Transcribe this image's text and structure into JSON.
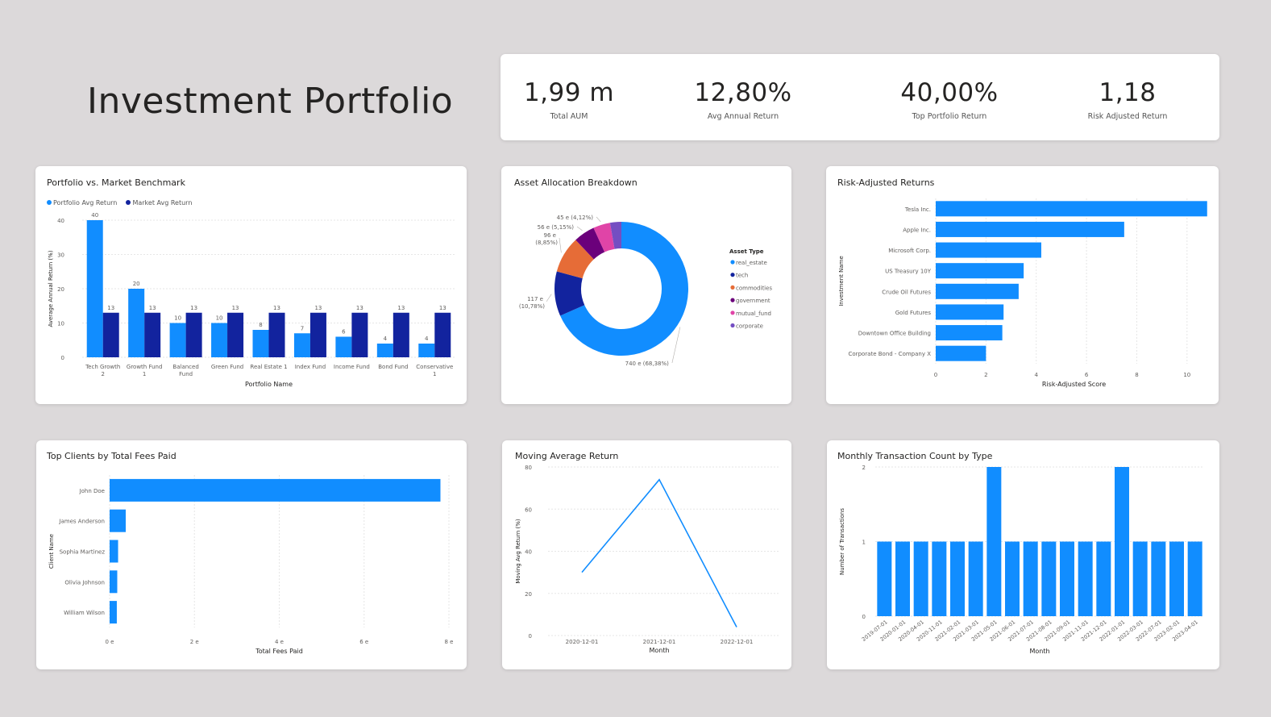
{
  "page": {
    "title": "Investment Portfolio"
  },
  "kpis": [
    {
      "value": "1,99 m",
      "label": "Total AUM"
    },
    {
      "value": "12,80%",
      "label": "Avg Annual Return"
    },
    {
      "value": "40,00%",
      "label": "Top Portfolio Return"
    },
    {
      "value": "1,18",
      "label": "Risk Adjusted Return"
    }
  ],
  "colors": {
    "blue": "#118dff",
    "navy": "#12239e",
    "orange": "#e66c37",
    "purple": "#6b007b",
    "pink": "#e044a7",
    "violet": "#744ec2"
  },
  "chart_data": [
    {
      "type": "bar",
      "title": "Portfolio vs. Market Benchmark",
      "xlabel": "Portfolio Name",
      "ylabel": "Average Annual Return (%)",
      "ylim": [
        0,
        40
      ],
      "yticks": [
        "0",
        "10",
        "20",
        "30",
        "40"
      ],
      "categories": [
        [
          "Tech Growth",
          "2"
        ],
        [
          "Growth Fund",
          "1"
        ],
        [
          "Balanced",
          "Fund"
        ],
        [
          "Green Fund"
        ],
        [
          "Real Estate 1"
        ],
        [
          "Index Fund"
        ],
        [
          "Income Fund"
        ],
        [
          "Bond Fund"
        ],
        [
          "Conservative",
          "1"
        ]
      ],
      "series": [
        {
          "name": "Portfolio Avg Return",
          "color": "#118dff",
          "values": [
            40,
            20,
            10,
            10,
            8,
            7,
            6,
            4,
            4
          ],
          "labels": [
            "40",
            "20",
            "10",
            "10",
            "8",
            "7",
            "6",
            "4",
            "4"
          ]
        },
        {
          "name": "Market Avg Return",
          "color": "#12239e",
          "values": [
            13,
            13,
            13,
            13,
            13,
            13,
            13,
            13,
            13
          ],
          "labels": [
            "13",
            "13",
            "13",
            "13",
            "13",
            "13",
            "13",
            "13",
            "13"
          ]
        }
      ],
      "legend": "top-left",
      "grid": true
    },
    {
      "type": "pie",
      "title": "Asset Allocation Breakdown",
      "legend_title": "Asset Type",
      "legend": "right",
      "slices": [
        {
          "name": "real_estate",
          "value": 68.38,
          "color": "#118dff",
          "label": "740 e (68,38%)"
        },
        {
          "name": "tech",
          "value": 10.78,
          "color": "#12239e",
          "label": "117 e (10,78%)"
        },
        {
          "name": "commodities",
          "value": 8.85,
          "color": "#e66c37",
          "label": "96 e (8,85%)"
        },
        {
          "name": "government",
          "value": 5.15,
          "color": "#6b007b",
          "label": "56 e (5,15%)"
        },
        {
          "name": "mutual_fund",
          "value": 4.12,
          "color": "#e044a7",
          "label": "45 e (4,12%)"
        },
        {
          "name": "corporate",
          "value": 2.72,
          "color": "#744ec2",
          "label": ""
        }
      ]
    },
    {
      "type": "bar",
      "orientation": "horizontal",
      "title": "Risk-Adjusted Returns",
      "xlabel": "Risk-Adjusted Score",
      "ylabel": "Investment Name",
      "xlim": [
        0,
        11
      ],
      "xticks": [
        "0",
        "2",
        "4",
        "6",
        "8",
        "10"
      ],
      "categories": [
        "Tesla Inc.",
        "Apple Inc.",
        "Microsoft Corp.",
        "US Treasury 10Y",
        "Crude Oil Futures",
        "Gold Futures",
        "Downtown Office Building",
        "Corporate Bond - Company X"
      ],
      "values": [
        10.8,
        7.5,
        4.2,
        3.5,
        3.3,
        2.7,
        2.65,
        2.0
      ]
    },
    {
      "type": "bar",
      "orientation": "horizontal",
      "title": "Top Clients by Total Fees Paid",
      "xlabel": "Total Fees Paid",
      "ylabel": "Client Name",
      "xlim": [
        0,
        8
      ],
      "xticks": [
        "0 e",
        "2 e",
        "4 e",
        "6 e",
        "8 e"
      ],
      "categories": [
        "John Doe",
        "James Anderson",
        "Sophia Martinez",
        "Olivia Johnson",
        "William Wilson"
      ],
      "values": [
        7.8,
        0.38,
        0.2,
        0.18,
        0.17
      ]
    },
    {
      "type": "line",
      "title": "Moving Average Return",
      "xlabel": "Month",
      "ylabel": "Moving Avg Return (%)",
      "ylim": [
        0,
        80
      ],
      "yticks": [
        "0",
        "20",
        "40",
        "60",
        "80"
      ],
      "x": [
        "2020-12-01",
        "2021-12-01",
        "2022-12-01"
      ],
      "values": [
        30,
        74,
        4
      ]
    },
    {
      "type": "bar",
      "title": "Monthly Transaction Count by Type",
      "xlabel": "Month",
      "ylabel": "Number of Transactions",
      "ylim": [
        0,
        2
      ],
      "yticks": [
        "0",
        "1",
        "2"
      ],
      "categories": [
        "2019-07-01",
        "2020-01-01",
        "2020-04-01",
        "2020-11-01",
        "2021-02-01",
        "2021-03-01",
        "2021-05-01",
        "2021-06-01",
        "2021-07-01",
        "2021-08-01",
        "2021-09-01",
        "2021-11-01",
        "2021-12-01",
        "2022-01-01",
        "2022-03-01",
        "2022-07-01",
        "2023-02-01",
        "2023-04-01"
      ],
      "values": [
        1,
        1,
        1,
        1,
        1,
        1,
        2,
        1,
        1,
        1,
        1,
        1,
        1,
        2,
        1,
        1,
        1,
        1
      ]
    }
  ]
}
